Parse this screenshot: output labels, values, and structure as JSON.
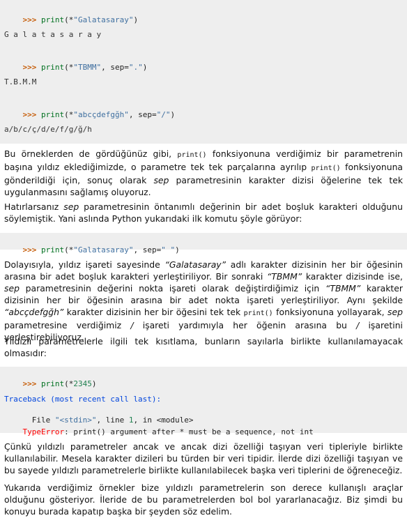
{
  "code1": {
    "l1": {
      "p": ">>>",
      "fn": "print",
      "a": "(*",
      "s": "\"Galatasaray\"",
      "b": ")"
    },
    "o1": "G a l a t a s a r a y",
    "l2": {
      "p": ">>>",
      "fn": "print",
      "a": "(*",
      "s": "\"TBMM\"",
      "m": ", sep=",
      "s2": "\".\"",
      "b": ")"
    },
    "o2": "T.B.M.M",
    "l3": {
      "p": ">>>",
      "fn": "print",
      "a": "(*",
      "s": "\"abcçdefgğh\"",
      "m": ", sep=",
      "s2": "\"/\"",
      "b": ")"
    },
    "o3": "a/b/c/ç/d/e/f/g/ğ/h"
  },
  "para1": {
    "t1": "Bu örneklerden de gördüğünüz gibi, ",
    "c1": "print()",
    "t2": " fonksiyonuna verdiğimiz bir parametrenin başına yıldız eklediğimizde, o parametre tek tek parçalarına ayrılıp ",
    "c2": "print()",
    "t3": " fonksiyonuna gönderildiği için, sonuç olarak ",
    "e1": "sep",
    "t4": " parametresinin karakter dizisi öğelerine tek tek uygulanmasını sağlamış oluyoruz."
  },
  "para2": {
    "t1": "Hatırlarsanız ",
    "e1": "sep",
    "t2": " parametresinin öntanımlı değerinin bir adet boşluk karakteri olduğunu söylemiştik. Yani aslında Python yukarıdaki ilk komutu şöyle görüyor:"
  },
  "code2": {
    "p": ">>>",
    "fn": "print",
    "a": "(*",
    "s": "\"Galatasaray\"",
    "m": ", sep=",
    "s2": "\" \"",
    "b": ")"
  },
  "para3": {
    "t1": "Dolayısıyla, yıldız işareti sayesinde ",
    "e1": "“Galatasaray”",
    "t2": " adlı karakter dizisinin her bir öğesinin arasına bir adet boşluk karakteri yerleştiriliyor. Bir sonraki ",
    "e2": "“TBMM”",
    "t3": " karakter dizisinde ise, ",
    "e3": "sep",
    "t4": " parametresinin değerini nokta işareti olarak değiştirdiğimiz için ",
    "e4": "“TBMM”",
    "t5": " karakter dizisinin her bir öğesinin arasına bir adet nokta işareti yerleştiriliyor. Aynı şekilde ",
    "e5": "“abcçdefgğh”",
    "t6": " karakter dizisinin her bir öğesini tek tek ",
    "c1": "print()",
    "t7": " fonksiyonuna yollayarak, ",
    "e6": "sep",
    "t8": " parametresine verdiğimiz ",
    "e7": "/",
    "t9": " işareti yardımıyla her öğenin arasına bu ",
    "e8": "/",
    "t10": " işaretini yerleştirebiliyoruz."
  },
  "para4": {
    "t1": "Yıldızlı parametrelerle ilgili tek kısıtlama, bunların sayılarla birlikte kullanılamayacak olmasıdır:"
  },
  "code3": {
    "l1": {
      "p": ">>>",
      "fn": "print",
      "a": "(*",
      "n": "2345",
      "b": ")"
    },
    "tb": "Traceback (most recent call last):",
    "file": {
      "a": "  File ",
      "s": "\"<stdin>\"",
      "b": ", line ",
      "n": "1",
      "c": ", in <module>"
    },
    "err": {
      "name": "TypeError",
      "msg": ": print() argument after * must be a sequence, not int"
    }
  },
  "para5": {
    "t1": "Çünkü yıldızlı parametreler ancak ve ancak dizi özelliği taşıyan veri tipleriyle birlikte kullanılabilir. Mesela karakter dizileri bu türden bir veri tipidir. İlerde dizi özelliği taşıyan ve bu sayede yıldızlı parametrelerle birlikte kullanılabilecek başka veri tiplerini de öğreneceğiz."
  },
  "para6": {
    "t1": "Yukarıda verdiğimiz örnekler bize yıldızlı parametrelerin son derece kullanışlı araçlar olduğunu gösteriyor. İleride de bu parametrelerden bol bol yararlanacağız. Biz şimdi bu konuyu burada kapatıp başka bir şeyden söz edelim."
  }
}
